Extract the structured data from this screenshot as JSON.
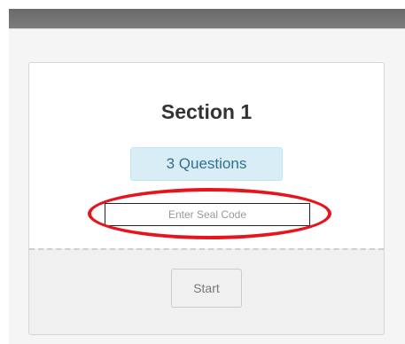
{
  "section": {
    "title": "Section 1",
    "question_count_label": "3 Questions"
  },
  "seal_code": {
    "placeholder": "Enter Seal Code",
    "value": ""
  },
  "actions": {
    "start_label": "Start"
  },
  "colors": {
    "header_bar": "#6f6f6f",
    "badge_background": "#d9edf7",
    "badge_text": "#31708f",
    "highlight": "#e8141b"
  }
}
